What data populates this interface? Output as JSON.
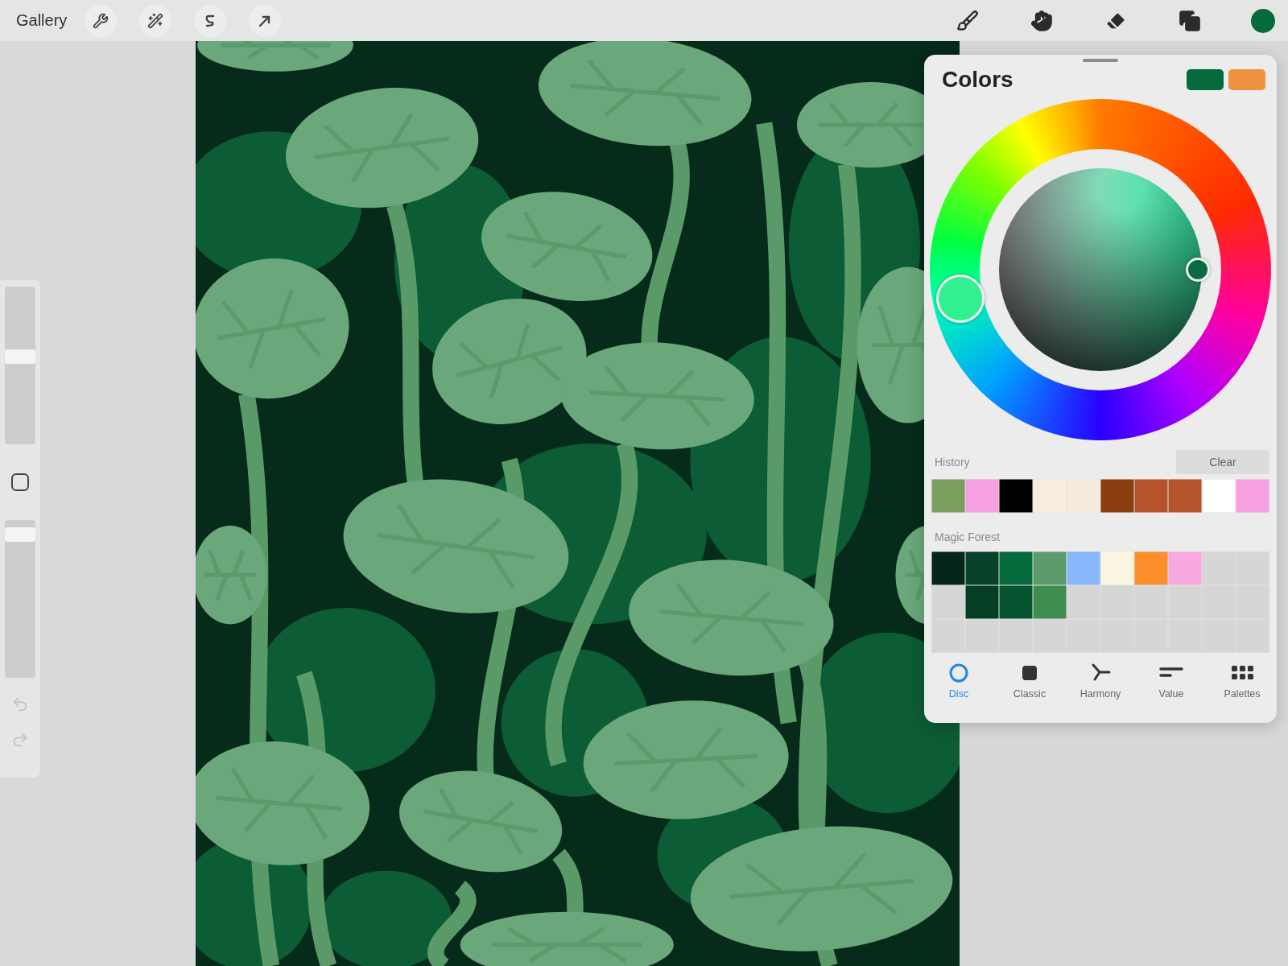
{
  "topbar": {
    "gallery": "Gallery",
    "left_tools": [
      {
        "kind": "wrench"
      },
      {
        "kind": "wand"
      },
      {
        "kind": "selection"
      },
      {
        "kind": "arrow"
      }
    ],
    "right_tools": [
      {
        "kind": "brush"
      },
      {
        "kind": "smudge"
      },
      {
        "kind": "eraser"
      },
      {
        "kind": "layers"
      },
      {
        "kind": "color",
        "color": "#066b3c"
      }
    ]
  },
  "sidebar": {
    "size_slider": {
      "level": 0.56
    },
    "opacity_slider": {
      "level": 0.95
    }
  },
  "colors_panel": {
    "title": "Colors",
    "current_swatches": [
      {
        "color": "#066b3c"
      },
      {
        "color": "#f0913f"
      }
    ],
    "history": {
      "label": "History",
      "clear": "Clear",
      "swatches": [
        {
          "color": "#7a9e5c"
        },
        {
          "color": "#f7a1e3"
        },
        {
          "color": "#000000"
        },
        {
          "color": "#f7eedf"
        },
        {
          "color": "#f5ebdc"
        },
        {
          "color": "#8a3e12"
        },
        {
          "color": "#b5532b"
        },
        {
          "color": "#b5532b"
        },
        {
          "color": "#ffffff"
        },
        {
          "color": "#f7a1e3"
        }
      ]
    },
    "palette": {
      "name": "Magic Forest",
      "swatches": [
        {
          "kind": "color",
          "color": "#06261a"
        },
        {
          "kind": "color",
          "color": "#07422a"
        },
        {
          "kind": "color",
          "color": "#066b3c"
        },
        {
          "kind": "color",
          "color": "#5b9b6c"
        },
        {
          "kind": "color",
          "color": "#88b7fb"
        },
        {
          "kind": "color",
          "color": "#fbf4e0"
        },
        {
          "kind": "color",
          "color": "#fc8f2c"
        },
        {
          "kind": "color",
          "color": "#f8a9e0"
        },
        {
          "kind": "empty"
        },
        {
          "kind": "empty"
        },
        {
          "kind": "empty"
        },
        {
          "kind": "color",
          "color": "#063e24"
        },
        {
          "kind": "color",
          "color": "#05532f"
        },
        {
          "kind": "color",
          "color": "#3f8c4f"
        },
        {
          "kind": "empty"
        },
        {
          "kind": "empty"
        },
        {
          "kind": "empty"
        },
        {
          "kind": "empty"
        },
        {
          "kind": "empty"
        },
        {
          "kind": "empty"
        },
        {
          "kind": "empty"
        },
        {
          "kind": "empty"
        },
        {
          "kind": "empty"
        },
        {
          "kind": "empty"
        },
        {
          "kind": "empty"
        },
        {
          "kind": "empty"
        },
        {
          "kind": "empty"
        },
        {
          "kind": "empty"
        },
        {
          "kind": "empty"
        },
        {
          "kind": "empty"
        }
      ]
    },
    "tabs": [
      {
        "label": "Disc",
        "kind": "disc",
        "selected": true
      },
      {
        "label": "Classic",
        "kind": "classic",
        "selected": false
      },
      {
        "label": "Harmony",
        "kind": "harmony",
        "selected": false
      },
      {
        "label": "Value",
        "kind": "value",
        "selected": false
      },
      {
        "label": "Palettes",
        "kind": "palettes",
        "selected": false
      }
    ]
  }
}
